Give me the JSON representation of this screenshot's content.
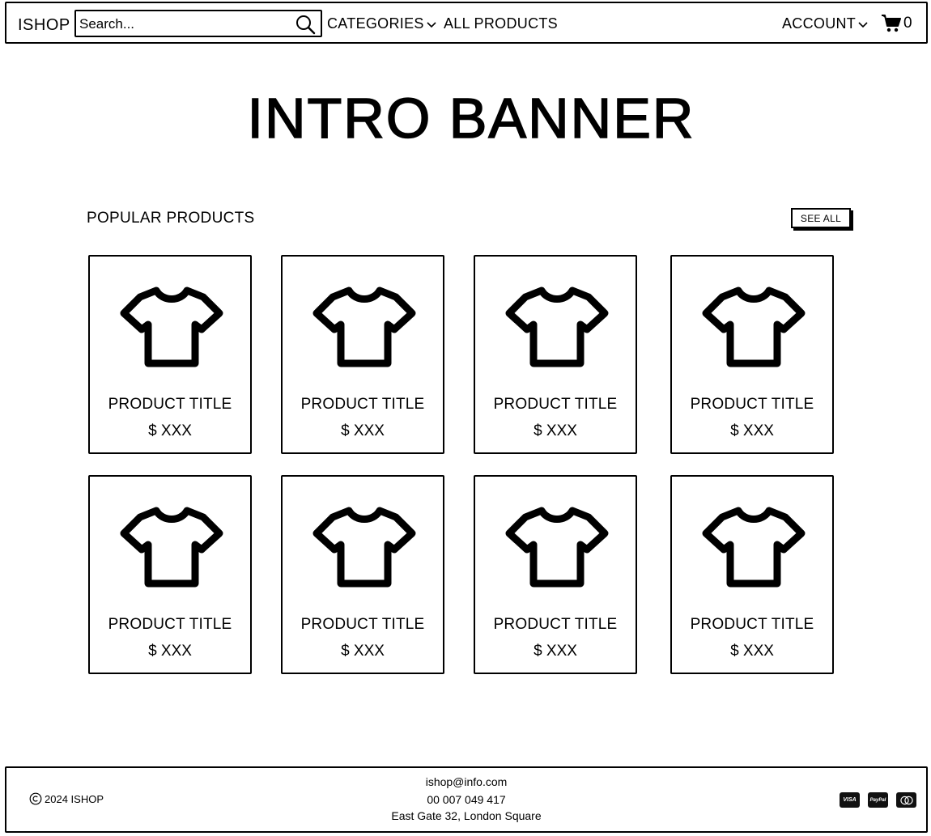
{
  "header": {
    "logo": "ISHOP",
    "search_placeholder": "Search...",
    "nav": {
      "categories": "CATEGORIES",
      "all_products": "ALL PRODUCTS",
      "account": "ACCOUNT"
    },
    "cart_count": "0"
  },
  "banner": {
    "title": "INTRO BANNER"
  },
  "popular": {
    "title": "POPULAR PRODUCTS",
    "see_all": "SEE ALL",
    "products": [
      {
        "title": "PRODUCT TITLE",
        "price": "$ XXX",
        "icon": "t-shirt-icon"
      },
      {
        "title": "PRODUCT TITLE",
        "price": "$ XXX",
        "icon": "t-shirt-icon"
      },
      {
        "title": "PRODUCT TITLE",
        "price": "$ XXX",
        "icon": "t-shirt-icon"
      },
      {
        "title": "PRODUCT TITLE",
        "price": "$ XXX",
        "icon": "t-shirt-icon"
      },
      {
        "title": "PRODUCT TITLE",
        "price": "$ XXX",
        "icon": "t-shirt-icon"
      },
      {
        "title": "PRODUCT TITLE",
        "price": "$ XXX",
        "icon": "t-shirt-icon"
      },
      {
        "title": "PRODUCT TITLE",
        "price": "$ XXX",
        "icon": "t-shirt-icon"
      },
      {
        "title": "PRODUCT TITLE",
        "price": "$ XXX",
        "icon": "t-shirt-icon"
      }
    ]
  },
  "footer": {
    "copyright": "2024 ISHOP",
    "email": "ishop@info.com",
    "phone": "00 007 049 417",
    "address": "East Gate 32, London Square",
    "payments": {
      "visa": "VISA",
      "paypal": "PayPal",
      "mastercard": "mastercard-icon"
    }
  }
}
